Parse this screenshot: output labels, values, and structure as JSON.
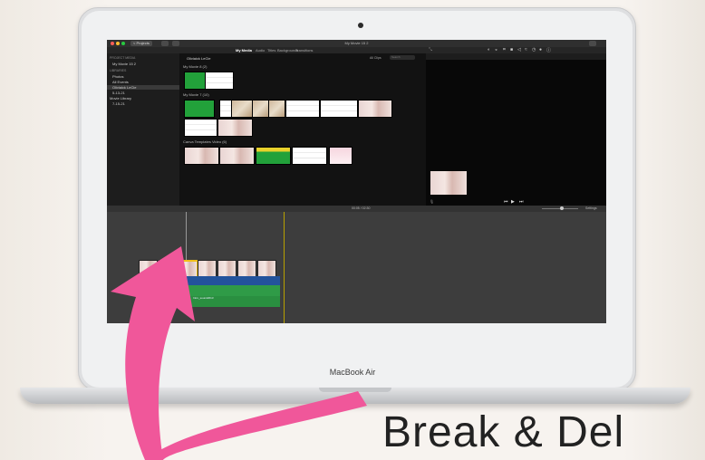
{
  "window": {
    "title": "My Movie 15 2",
    "projects_label": "< Projects"
  },
  "toolbar": {
    "tabs": [
      "My Media",
      "Audio",
      "Titles",
      "Backgrounds",
      "Transitions"
    ],
    "active_tab": "My Media"
  },
  "sidebar": {
    "project_media_header": "PROJECT MEDIA",
    "project_item": "My Movie 15 2",
    "libraries_header": "LIBRARIES",
    "items": [
      "Photos",
      "All Events",
      "iMovie Library",
      "5-13-21",
      "7-15-21"
    ],
    "selected_item": "Oliviaick LeCie",
    "extra_item": "Movie Library"
  },
  "browser": {
    "title": "Oliviaick LeCie",
    "filter": "All Clips",
    "search_placeholder": "Search",
    "groups": [
      {
        "label": "My Movie 8  (2)"
      },
      {
        "label": "My Movie 7  (10)"
      },
      {
        "label": "Canva Templates Video  (6)"
      }
    ]
  },
  "timeline": {
    "time": "00:05 / 02:30",
    "settings_label": "Settings",
    "clip_title": "Intro_sound2013"
  },
  "laptop": {
    "brand": "MacBook Air"
  },
  "caption": {
    "text": "Break & Del"
  },
  "colors": {
    "arrow": "#f0579a",
    "selection": "#f2c01a",
    "clip_blue": "#23539c",
    "clip_green": "#2f9b47"
  }
}
